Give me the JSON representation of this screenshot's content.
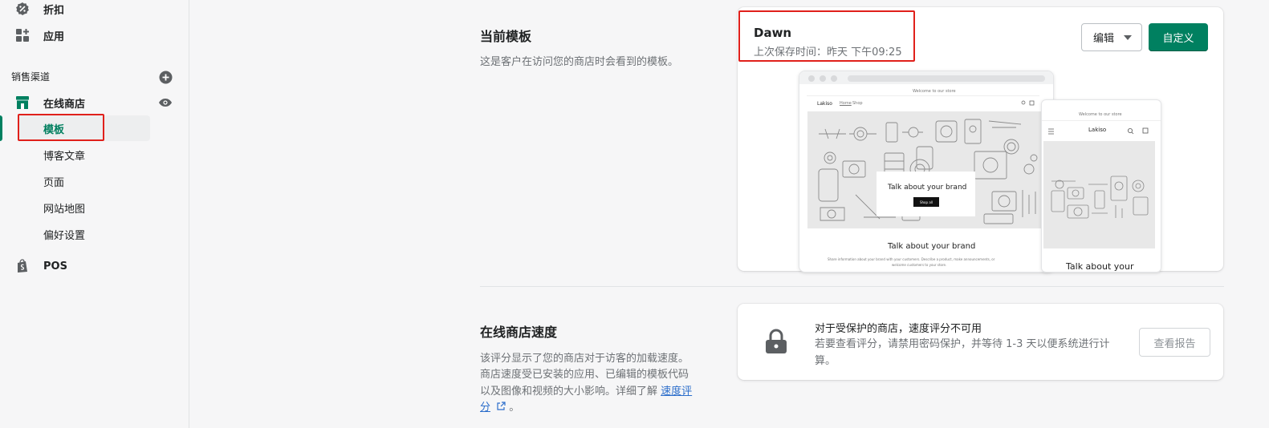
{
  "sidebar": {
    "top_items": [
      {
        "label": "折扣",
        "icon": "discount-icon"
      },
      {
        "label": "应用",
        "icon": "apps-icon"
      }
    ],
    "sales_channels_title": "销售渠道",
    "online_store": {
      "label": "在线商店",
      "sub_items": [
        {
          "label": "模板",
          "active": true
        },
        {
          "label": "博客文章"
        },
        {
          "label": "页面"
        },
        {
          "label": "网站地图"
        },
        {
          "label": "偏好设置"
        }
      ]
    },
    "pos_label": "POS"
  },
  "current_theme": {
    "section_title": "当前模板",
    "section_desc": "这是客户在访问您的商店时会看到的模板。",
    "theme_name": "Dawn",
    "last_saved": "上次保存时间：昨天 下午09:25",
    "edit_button": "编辑",
    "customize_button": "自定义",
    "preview": {
      "announcement": "Welcome to our store",
      "store_name": "Lakiso",
      "nav_home": "Home",
      "nav_shop": "Shop",
      "banner_heading": "Talk about your brand",
      "banner_button": "Shop all",
      "text_heading": "Talk about your brand",
      "text_line_1": "Share information about your brand with your customers. Describe a product, make announcements, or",
      "text_line_2": "welcome customers to your store.",
      "mobile_heading": "Talk about your"
    }
  },
  "store_speed": {
    "section_title": "在线商店速度",
    "desc_line_1": "该评分显示了您的商店对于访客的加载速度。",
    "desc_line_2": "商店速度受已安装的应用、已编辑的模板代码",
    "desc_line_3": "以及图像和视频的大小影响。详细了解",
    "link_part_1": "速度评",
    "link_part_2": "分",
    "desc_end": "。",
    "card_title": "对于受保护的商店，速度评分不可用",
    "card_desc": "若要查看评分，请禁用密码保护，并等待 1-3 天以便系统进行计算。",
    "report_button": "查看报告"
  },
  "colors": {
    "accent": "#008060",
    "highlight_box": "#e0201b",
    "link": "#2c6ecb"
  }
}
